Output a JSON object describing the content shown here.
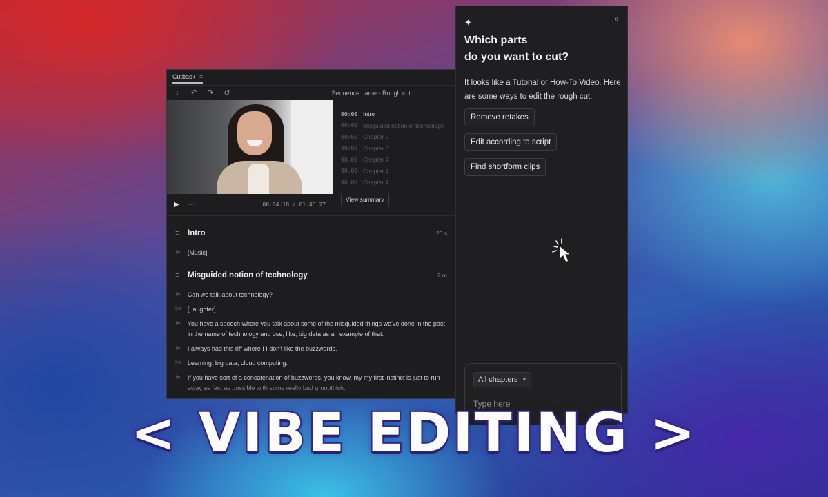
{
  "editor": {
    "tab_label": "Cutback",
    "sequence_name": "Sequence name - Rough cut",
    "player": {
      "timecode": "00:04:18 / 01:45:27"
    },
    "chapters": [
      {
        "time": "00:00",
        "name": "Intro",
        "active": true
      },
      {
        "time": "00:00",
        "name": "Misguided notion of technology",
        "active": false
      },
      {
        "time": "00:00",
        "name": "Chapter 2",
        "active": false
      },
      {
        "time": "00:00",
        "name": "Chapter 3",
        "active": false
      },
      {
        "time": "00:00",
        "name": "Chapter 4",
        "active": false
      },
      {
        "time": "00:00",
        "name": "Chapter 4",
        "active": false
      },
      {
        "time": "00:00",
        "name": "Chapter 4",
        "active": false
      }
    ],
    "view_summary_label": "View summary",
    "transcript": {
      "sections": [
        {
          "title": "Intro",
          "duration": "20 s",
          "lines": [
            "[Music]"
          ]
        },
        {
          "title": "Misguided notion of technology",
          "duration": "2 m",
          "lines": [
            "Can we talk about technology?",
            "[Laughter]",
            "You have a speech where you talk about some of the misguided things we've done in the past in the name of technology and use, like, big data as an example of that.",
            "I always had this riff where I I don't like the buzzwords.",
            "Learning, big data, cloud computing.",
            "If you have sort of a concatenation of buzzwords, you know, my my first instinct is just to run away as fast as possible with some really bad groupthink."
          ]
        }
      ]
    }
  },
  "panel": {
    "title_line1": "Which parts",
    "title_line2": "do you want to cut?",
    "message": "It looks like a Tutorial or How-To Video. Here are some ways to edit the rough cut.",
    "suggestions": [
      "Remove retakes",
      "Edit according to script",
      "Find shortform clips"
    ],
    "chapter_filter": "All chapters",
    "input_placeholder": "Type here"
  },
  "headline": "< VIBE EDITING >"
}
